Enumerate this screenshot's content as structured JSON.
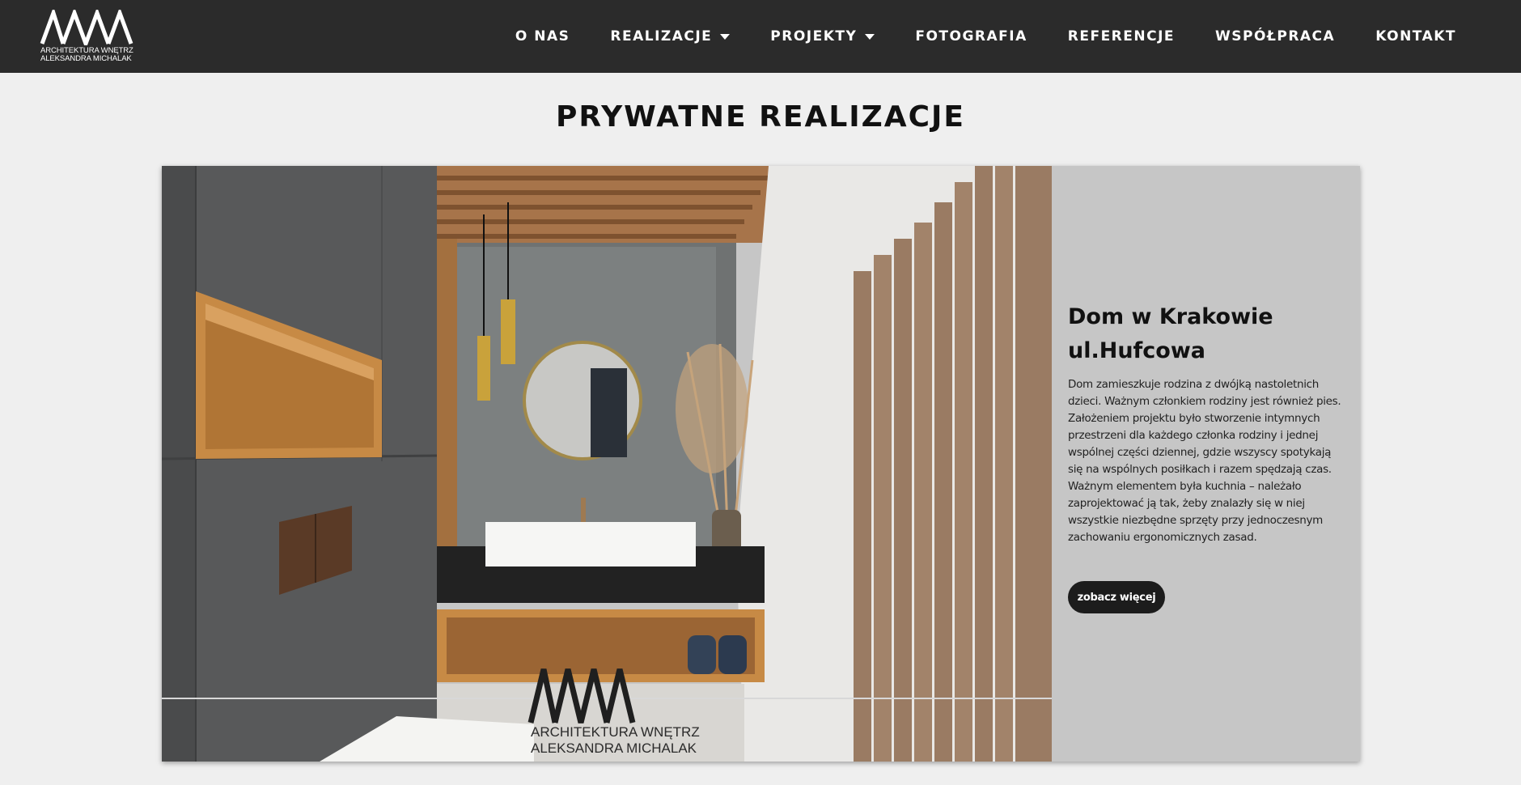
{
  "header": {
    "logo_line1": "ARCHITEKTURA WNĘTRZ",
    "logo_line2": "ALEKSANDRA MICHALAK",
    "nav": [
      {
        "label": "O NAS",
        "has_dropdown": false
      },
      {
        "label": "REALIZACJE",
        "has_dropdown": true
      },
      {
        "label": "PROJEKTY",
        "has_dropdown": true
      },
      {
        "label": "FOTOGRAFIA",
        "has_dropdown": false
      },
      {
        "label": "REFERENCJE",
        "has_dropdown": false
      },
      {
        "label": "WSPÓŁPRACA",
        "has_dropdown": false
      },
      {
        "label": "KONTAKT",
        "has_dropdown": false
      }
    ]
  },
  "page": {
    "title": "PRYWATNE REALIZACJE"
  },
  "project": {
    "title": "Dom w Krakowie ul.Hufcowa",
    "description": "Dom zamieszkuje rodzina z dwójką nastoletnich dzieci. Ważnym członkiem rodziny jest również pies. Założeniem projektu było stworzenie intymnych przestrzeni dla każdego członka rodziny i jednej wspólnej części dziennej, gdzie wszyscy spotykają się na wspólnych posiłkach i razem spędzają czas. Ważnym elementem była kuchnia – należało zaprojektować ją tak, żeby znalazły się w niej wszystkie niezbędne sprzęty przy jednoczesnym zachowaniu ergonomicznych zasad.",
    "button_label": "zobacz więcej",
    "watermark_line1": "ARCHITEKTURA WNĘTRZ",
    "watermark_line2": "ALEKSANDRA MICHALAK"
  },
  "colors": {
    "header_bg": "#2b2b2b",
    "page_bg": "#efefef",
    "panel_bg": "#c6c6c6",
    "button_bg": "#1c1c1c"
  },
  "icons": {
    "logo": "logo-mark-icon",
    "dropdown": "caret-down-icon"
  }
}
